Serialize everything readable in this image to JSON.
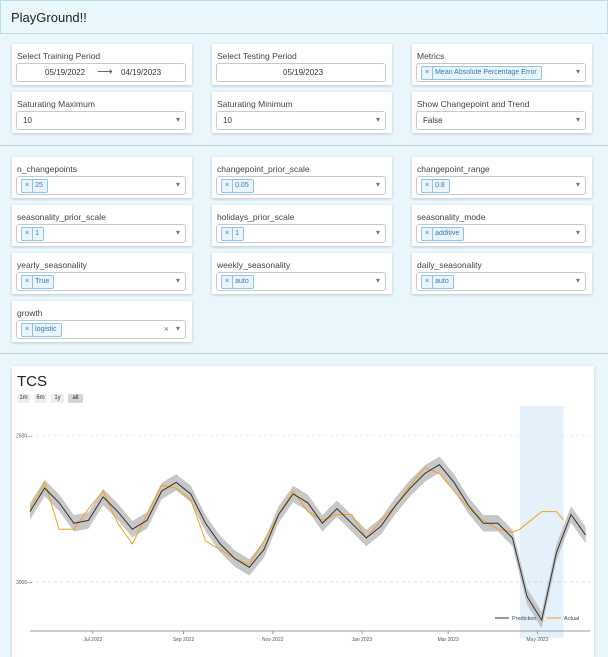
{
  "app": {
    "title": "PlayGround!!"
  },
  "controls": {
    "training": {
      "label": "Select Training Period",
      "start": "05/19/2022",
      "end": "04/19/2023"
    },
    "testing": {
      "label": "Select Testing Period",
      "start": "",
      "end": "05/19/2023"
    },
    "metrics": {
      "label": "Metrics",
      "value": "Mean Absolute Percentage Error"
    },
    "sat_max": {
      "label": "Saturating Maximum",
      "value": "10"
    },
    "sat_min": {
      "label": "Saturating Minimum",
      "value": "10"
    },
    "show_cp": {
      "label": "Show Changepoint and Trend",
      "value": "False"
    },
    "n_changepoints": {
      "label": "n_changepoints",
      "value": "25"
    },
    "cp_prior_scale": {
      "label": "changepoint_prior_scale",
      "value": "0.05"
    },
    "cp_range": {
      "label": "changepoint_range",
      "value": "0.8"
    },
    "seas_prior_scale": {
      "label": "seasonality_prior_scale",
      "value": "1"
    },
    "hol_prior_scale": {
      "label": "holidays_prior_scale",
      "value": "1"
    },
    "seas_mode": {
      "label": "seasonality_mode",
      "value": "additive"
    },
    "yearly": {
      "label": "yearly_seasonality",
      "value": "True"
    },
    "weekly": {
      "label": "weekly_seasonality",
      "value": "auto"
    },
    "daily": {
      "label": "daily_seasonality",
      "value": "auto"
    },
    "growth": {
      "label": "growth",
      "value": "logistic"
    }
  },
  "icons": {
    "clear": "×",
    "caret": "▾",
    "arrow": "⟶"
  },
  "range_buttons": [
    "1m",
    "6m",
    "1y",
    "all"
  ],
  "colors": {
    "prediction": "#333333",
    "actual": "#f0a21c",
    "band": "#bdbdbd",
    "highlight": "#e4f1fb"
  },
  "chart_data": {
    "type": "line",
    "title": "TCS",
    "x_ticks": [
      "Jul 2022",
      "Sep 2022",
      "Nov 2022",
      "Jan 2023",
      "Mar 2023",
      "May 2023"
    ],
    "y_ticks": [
      "3000",
      "2500"
    ],
    "ylim": [
      2850,
      3600
    ],
    "legend": [
      "Prediction",
      "Actual"
    ],
    "legend_position": "bottom-right",
    "highlight_region": [
      "2023-04-19",
      "2023-05-19"
    ],
    "series": [
      {
        "name": "Prediction",
        "x": [
          "2022-05-19",
          "2022-05-29",
          "2022-06-08",
          "2022-06-18",
          "2022-06-28",
          "2022-07-08",
          "2022-07-18",
          "2022-07-28",
          "2022-08-07",
          "2022-08-17",
          "2022-08-27",
          "2022-09-06",
          "2022-09-16",
          "2022-09-26",
          "2022-10-06",
          "2022-10-16",
          "2022-10-26",
          "2022-11-05",
          "2022-11-15",
          "2022-11-25",
          "2022-12-05",
          "2022-12-15",
          "2022-12-25",
          "2023-01-04",
          "2023-01-14",
          "2023-01-24",
          "2023-02-03",
          "2023-02-13",
          "2023-02-23",
          "2023-03-05",
          "2023-03-15",
          "2023-03-25",
          "2023-04-04",
          "2023-04-14",
          "2023-04-24",
          "2023-05-04",
          "2023-05-14",
          "2023-05-24",
          "2023-06-03"
        ],
        "values": [
          3240,
          3320,
          3270,
          3200,
          3210,
          3290,
          3240,
          3180,
          3210,
          3310,
          3340,
          3300,
          3200,
          3130,
          3080,
          3050,
          3110,
          3230,
          3300,
          3270,
          3200,
          3250,
          3200,
          3150,
          3190,
          3260,
          3320,
          3370,
          3400,
          3340,
          3260,
          3200,
          3200,
          3150,
          2950,
          2870,
          3100,
          3230,
          3160
        ]
      },
      {
        "name": "Actual",
        "x": [
          "2022-05-19",
          "2022-05-29",
          "2022-06-08",
          "2022-06-18",
          "2022-06-28",
          "2022-07-08",
          "2022-07-18",
          "2022-07-28",
          "2022-08-07",
          "2022-08-17",
          "2022-08-27",
          "2022-09-06",
          "2022-09-16",
          "2022-09-26",
          "2022-10-06",
          "2022-10-16",
          "2022-10-26",
          "2022-11-05",
          "2022-11-15",
          "2022-11-25",
          "2022-12-05",
          "2022-12-15",
          "2022-12-25",
          "2023-01-04",
          "2023-01-14",
          "2023-01-24",
          "2023-02-03",
          "2023-02-13",
          "2023-02-23",
          "2023-03-05",
          "2023-03-15",
          "2023-03-25",
          "2023-04-04",
          "2023-04-14",
          "2023-04-19",
          "2023-04-24",
          "2023-05-04",
          "2023-05-14",
          "2023-05-19"
        ],
        "values": [
          3250,
          3340,
          3180,
          3180,
          3250,
          3310,
          3200,
          3130,
          3230,
          3330,
          3320,
          3280,
          3140,
          3110,
          3080,
          3060,
          3140,
          3230,
          3310,
          3240,
          3210,
          3230,
          3230,
          3150,
          3210,
          3260,
          3330,
          3390,
          3370,
          3310,
          3250,
          3210,
          3180,
          3170,
          3180,
          3200,
          3240,
          3240,
          3210
        ]
      }
    ]
  }
}
